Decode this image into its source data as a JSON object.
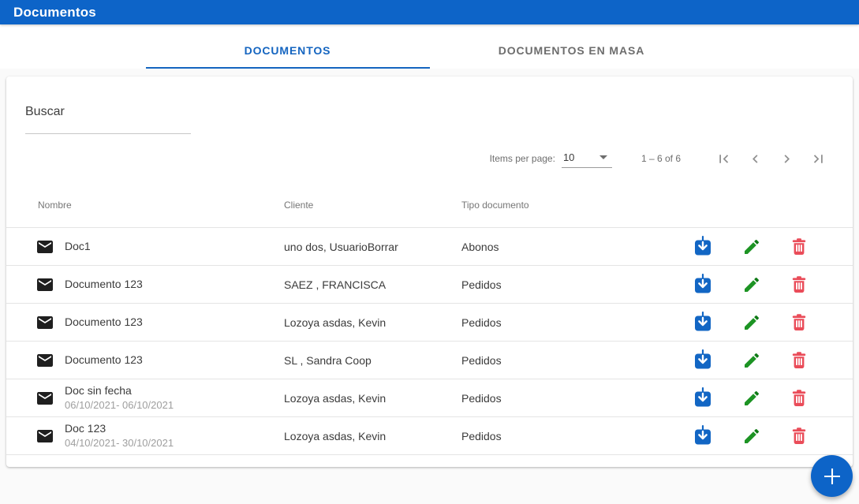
{
  "app_bar": {
    "title": "Documentos"
  },
  "tabs": [
    {
      "label": "DOCUMENTOS",
      "active": true
    },
    {
      "label": "DOCUMENTOS EN MASA",
      "active": false
    }
  ],
  "search": {
    "label": "Buscar"
  },
  "paginator": {
    "items_per_page_label": "Items per page:",
    "page_size": "10",
    "range_label": "1 – 6 of 6"
  },
  "table": {
    "columns": [
      "Nombre",
      "Cliente",
      "Tipo documento"
    ],
    "rows": [
      {
        "name": "Doc1",
        "dates": "",
        "client": "uno dos, UsuarioBorrar",
        "type": "Abonos"
      },
      {
        "name": "Documento 123",
        "dates": "",
        "client": "SAEZ , FRANCISCA",
        "type": "Pedidos"
      },
      {
        "name": "Documento 123",
        "dates": "",
        "client": "Lozoya asdas, Kevin",
        "type": "Pedidos"
      },
      {
        "name": "Documento 123",
        "dates": "",
        "client": "SL , Sandra Coop",
        "type": "Pedidos"
      },
      {
        "name": "Doc sin fecha",
        "dates": "06/10/2021- 06/10/2021",
        "client": "Lozoya asdas, Kevin",
        "type": "Pedidos"
      },
      {
        "name": "Doc 123",
        "dates": "04/10/2021- 30/10/2021",
        "client": "Lozoya asdas, Kevin",
        "type": "Pedidos"
      }
    ]
  },
  "icons": {
    "row_icon": "email-icon",
    "row_actions": [
      "download-icon",
      "edit-pencil-icon",
      "delete-trash-icon"
    ],
    "fab": "plus-icon"
  },
  "colors": {
    "primary_blue": "#0d64c8",
    "tab_active_blue": "#1565c0",
    "edit_green": "#1d9424",
    "delete_red": "#ea4c59",
    "page_background": "#fafafa"
  }
}
